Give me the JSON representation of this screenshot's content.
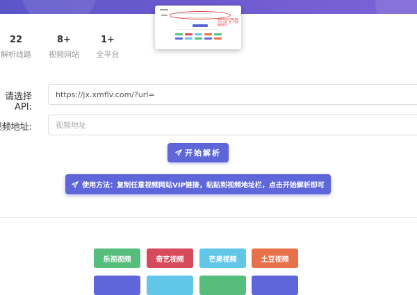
{
  "preview": {
    "note": "需要填进的切换线路方法上面，选「开始解析即可」"
  },
  "stats": [
    {
      "value": "22",
      "label": "解析线路"
    },
    {
      "value": "8+",
      "label": "视频网站"
    },
    {
      "value": "1+",
      "label": "全平台"
    }
  ],
  "form": {
    "api_label": "请选择API:",
    "api_value": "https://jx.xmflv.com/?url=",
    "url_label": "视频地址:",
    "url_placeholder": "视频地址"
  },
  "actions": {
    "start_label": "开始解析",
    "usage_text": "使用方法：复制任意视频网站VIP链接，粘贴到视频地址栏，点击开始解析即可"
  },
  "sites": [
    {
      "label": "乐视视频",
      "color": "#56bd7c"
    },
    {
      "label": "奇艺视频",
      "color": "#d64b5b"
    },
    {
      "label": "芒果视频",
      "color": "#62c6e8"
    },
    {
      "label": "土豆视频",
      "color": "#e8714a"
    }
  ],
  "sites_row2_colors": [
    "#5e66d9",
    "#62c6e8",
    "#56bd7c",
    "#5e66d9"
  ],
  "colors": {
    "accent": "#5e66d9",
    "hero": "#6f5bd0"
  }
}
